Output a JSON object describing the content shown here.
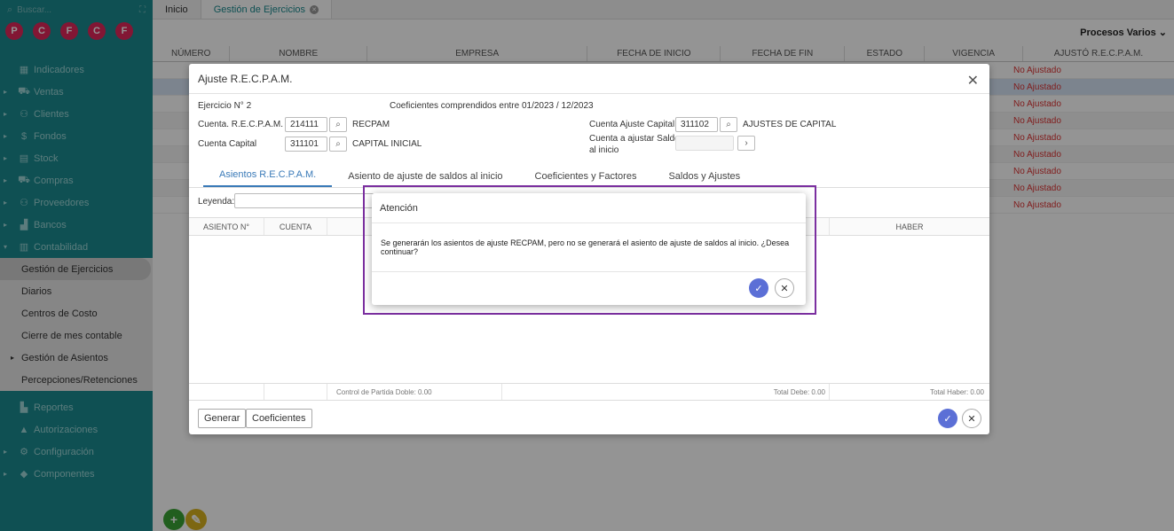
{
  "sidebar": {
    "search_placeholder": "Buscar...",
    "badges": [
      {
        "letter": "P",
        "color": "#e0265a"
      },
      {
        "letter": "C",
        "color": "#e0265a"
      },
      {
        "letter": "F",
        "color": "#e0265a"
      },
      {
        "letter": "C",
        "color": "#e0265a"
      },
      {
        "letter": "F",
        "color": "#e0265a"
      }
    ],
    "items": [
      {
        "label": "Indicadores",
        "icon": "dashboard-icon"
      },
      {
        "label": "Ventas",
        "icon": "cart-icon"
      },
      {
        "label": "Clientes",
        "icon": "users-icon"
      },
      {
        "label": "Fondos",
        "icon": "dollar-icon"
      },
      {
        "label": "Stock",
        "icon": "box-icon"
      },
      {
        "label": "Compras",
        "icon": "cart-icon"
      },
      {
        "label": "Proveedores",
        "icon": "users-icon"
      },
      {
        "label": "Bancos",
        "icon": "bank-icon"
      },
      {
        "label": "Contabilidad",
        "icon": "book-icon"
      }
    ],
    "contabilidad_sub": [
      "Gestión de Ejercicios",
      "Diarios",
      "Centros de Costo",
      "Cierre de mes contable",
      "Gestión de Asientos",
      "Percepciones/Retenciones"
    ],
    "items_after": [
      {
        "label": "Reportes",
        "icon": "report-icon"
      },
      {
        "label": "Autorizaciones",
        "icon": "lock-icon"
      },
      {
        "label": "Configuración",
        "icon": "gear-icon"
      },
      {
        "label": "Componentes",
        "icon": "puzzle-icon"
      }
    ],
    "fab_add": "+",
    "fab_edit": "✎"
  },
  "topbar": {
    "tabs": [
      {
        "label": "Inicio"
      },
      {
        "label": "Gestión de Ejercicios"
      }
    ],
    "procesos": "Procesos Varios"
  },
  "grid": {
    "columns": [
      "NÚMERO",
      "NOMBRE",
      "EMPRESA",
      "FECHA DE INICIO",
      "FECHA DE FIN",
      "ESTADO",
      "VIGENCIA",
      "AJUSTÓ R.E.C.P.A.M."
    ],
    "rows": [
      "No Ajustado",
      "No Ajustado",
      "No Ajustado",
      "No Ajustado",
      "No Ajustado",
      "No Ajustado",
      "No Ajustado",
      "No Ajustado",
      "No Ajustado"
    ]
  },
  "modal": {
    "title": "Ajuste R.E.C.P.A.M.",
    "ejercicio": "Ejercicio N° 2",
    "coeficientes": "Coeficientes comprendidos entre 01/2023 / 12/2023",
    "cuenta_recpam_label": "Cuenta. R.E.C.P.A.M.",
    "cuenta_recpam_code": "214111",
    "cuenta_recpam_name": "RECPAM",
    "cuenta_capital_label": "Cuenta Capital",
    "cuenta_capital_code": "311101",
    "cuenta_capital_name": "CAPITAL INICIAL",
    "cuenta_ajuste_label": "Cuenta Ajuste Capital",
    "cuenta_ajuste_code": "311102",
    "cuenta_ajuste_name": "AJUSTES DE CAPITAL",
    "cuenta_saldos_label_1": "Cuenta a ajustar Saldos",
    "cuenta_saldos_label_2": "al inicio",
    "tabs": [
      "Asientos R.E.C.P.A.M.",
      "Asiento de ajuste de saldos al inicio",
      "Coeficientes y Factores",
      "Saldos y Ajustes"
    ],
    "leyenda_label": "Leyenda:",
    "grid_columns": [
      "ASIENTO N°",
      "CUENTA",
      "HABER"
    ],
    "control": "Control de Partida Doble: 0.00",
    "total_debe": "Total Debe: 0.00",
    "total_haber": "Total Haber: 0.00",
    "btn_generar": "Generar",
    "btn_coeficientes": "Coeficientes"
  },
  "dialog": {
    "title": "Atención",
    "message": "Se generarán los asientos de ajuste RECPAM, pero no se generará el asiento de ajuste de saldos al inicio. ¿Desea continuar?"
  },
  "colors": {
    "sidebar": "#1a8b8f",
    "accent_blue": "#5b6fd6",
    "highlight_frame": "#7b2fa0",
    "status_red": "#d33"
  }
}
